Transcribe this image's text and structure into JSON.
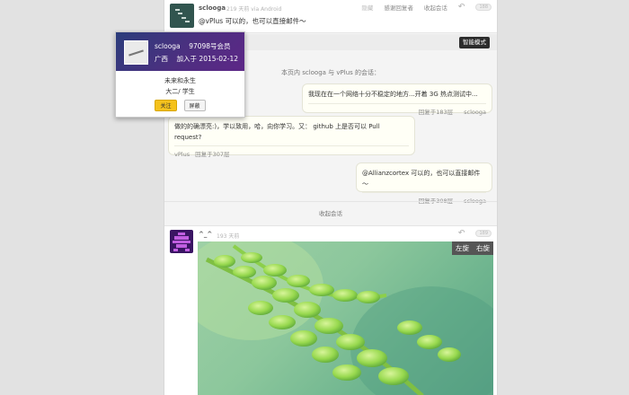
{
  "top_reply": {
    "username": "sclooga",
    "meta": "219 天前 via Android",
    "actions": [
      "隐藏",
      "感谢回复者",
      "收起会话"
    ],
    "count": "188",
    "content": "@vPlus 可以的，也可以直接邮件～"
  },
  "smart_mode_label": "智能模式",
  "conversation_title": "本页内 sclooga 与 vPlus 的会话：",
  "bubbles": [
    {
      "text": "我现在在一个网络十分不稳定的地方...开着 3G 热点测试中...",
      "floor": "回复于183层",
      "user": "sclooga"
    },
    {
      "text": "做的的确漂亮:)，学以致用，哈，向你学习。又： github 上是否可以 Pull request?",
      "floor": "回复于307层",
      "user": "vPlus"
    },
    {
      "text": "@Allianzcortex 可以的，也可以直接邮件～",
      "floor": "回复于308层",
      "user": "sclooga"
    }
  ],
  "collapse_label": "收起会话",
  "bottom_reply": {
    "username": "^_^",
    "meta": "193 天前",
    "count": "189",
    "rotate_left": "左旋",
    "rotate_right": "右旋"
  },
  "user_card": {
    "name": "sclooga",
    "member_no": "97098号会员",
    "region": "广西",
    "joined": "加入于 2015-02-12",
    "bio": "未来和永生",
    "job": "大二/ 学生",
    "follow_label": "关注",
    "block_label": "屏蔽"
  },
  "colors": {
    "smart_button": "#2c2c2c",
    "follow_button": "#f5c21b",
    "card_header": "#3b3480"
  }
}
